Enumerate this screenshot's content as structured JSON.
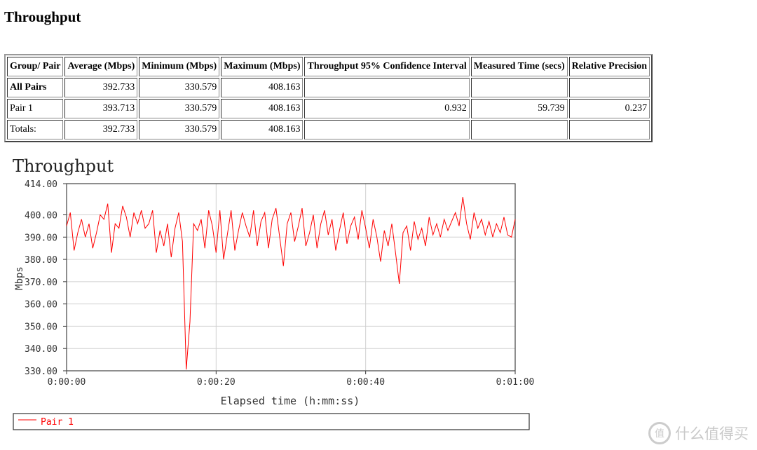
{
  "page_title": "Throughput",
  "table": {
    "headers": [
      "Group/ Pair",
      "Average (Mbps)",
      "Minimum (Mbps)",
      "Maximum (Mbps)",
      "Throughput 95% Confidence Interval",
      "Measured Time (secs)",
      "Relative Precision"
    ],
    "rows": [
      [
        "All Pairs",
        "392.733",
        "330.579",
        "408.163",
        "",
        "",
        ""
      ],
      [
        "Pair 1",
        "393.713",
        "330.579",
        "408.163",
        "0.932",
        "59.739",
        "0.237"
      ],
      [
        "Totals:",
        "392.733",
        "330.579",
        "408.163",
        "",
        "",
        ""
      ]
    ]
  },
  "chart_data": {
    "type": "line",
    "title": "Throughput",
    "xlabel": "Elapsed time (h:mm:ss)",
    "ylabel": "Mbps",
    "xlim": [
      0,
      60
    ],
    "ylim": [
      330,
      414
    ],
    "x_ticks": [
      {
        "v": 0,
        "label": "0:00:00"
      },
      {
        "v": 20,
        "label": "0:00:20"
      },
      {
        "v": 40,
        "label": "0:00:40"
      },
      {
        "v": 60,
        "label": "0:01:00"
      }
    ],
    "y_ticks": [
      {
        "v": 414,
        "label": "414.00"
      },
      {
        "v": 400,
        "label": "400.00"
      },
      {
        "v": 390,
        "label": "390.00"
      },
      {
        "v": 380,
        "label": "380.00"
      },
      {
        "v": 370,
        "label": "370.00"
      },
      {
        "v": 360,
        "label": "360.00"
      },
      {
        "v": 350,
        "label": "350.00"
      },
      {
        "v": 340,
        "label": "340.00"
      },
      {
        "v": 330,
        "label": "330.00"
      }
    ],
    "grid": true,
    "legend_placement": "bottom",
    "series": [
      {
        "name": "Pair 1",
        "color": "#ff0000",
        "values": [
          395,
          401,
          384,
          392,
          398,
          390,
          396,
          385,
          392,
          400,
          398,
          405,
          383,
          396,
          394,
          404,
          399,
          390,
          401,
          396,
          402,
          394,
          396,
          402,
          383,
          393,
          386,
          396,
          381,
          394,
          401,
          388,
          330.6,
          352,
          396,
          393,
          398,
          385,
          402,
          395,
          383,
          402,
          380,
          391,
          402,
          384,
          393,
          401,
          395,
          390,
          402,
          386,
          397,
          401,
          385,
          398,
          403,
          390,
          377,
          396,
          401,
          388,
          395,
          403,
          386,
          392,
          400,
          385,
          396,
          402,
          391,
          398,
          384,
          393,
          401,
          387,
          395,
          399,
          389,
          402,
          394,
          385,
          398,
          390,
          379,
          393,
          386,
          396,
          383,
          369,
          392,
          395,
          384,
          397,
          389,
          394,
          386,
          399,
          391,
          396,
          390,
          398,
          393,
          397,
          401,
          395,
          408,
          396,
          389,
          401,
          394,
          398,
          391,
          397,
          390,
          396,
          392,
          399,
          391,
          390,
          398
        ],
        "x_step_seconds": 0.5
      }
    ]
  },
  "watermark": "什么值得买"
}
